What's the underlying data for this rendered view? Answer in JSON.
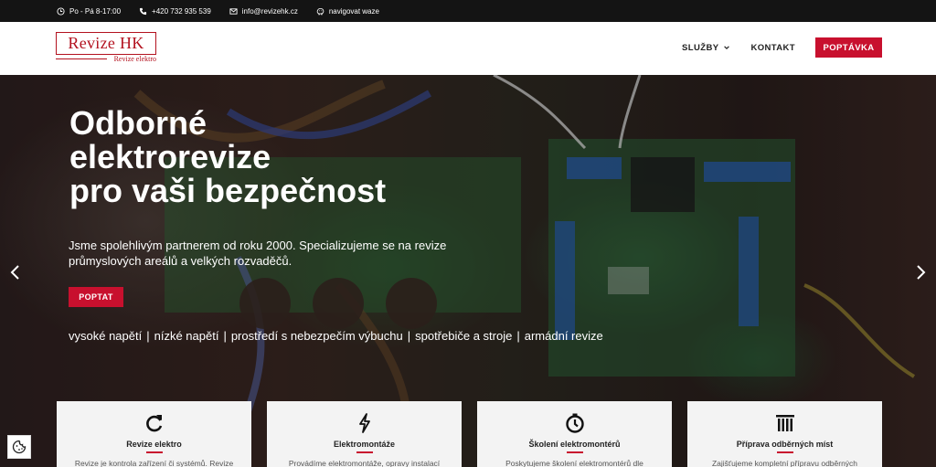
{
  "topbar": {
    "hours": "Po - Pá 8-17:00",
    "phone": "+420 732 935 539",
    "email": "info@revizehk.cz",
    "waze": "navigovat waze"
  },
  "header": {
    "logo_title": "Revize HK",
    "logo_subtitle": "Revize elektro",
    "nav": [
      {
        "label": "SLUŽBY"
      },
      {
        "label": "KONTAKT"
      }
    ],
    "cta_label": "POPTÁVKA"
  },
  "hero": {
    "title_lines": [
      "Odborné",
      "elektrorevize",
      "pro vaši bezpečnost"
    ],
    "text": "Jsme spolehlivým partnerem od roku 2000. Specializujeme se na revize průmyslových areálů a velkých rozvaděčů.",
    "button_label": "POPTAT",
    "tags": [
      "vysoké napětí",
      "nízké napětí",
      "prostředí s nebezpečím výbuchu",
      "spotřebiče a stroje",
      "armádní revize"
    ]
  },
  "cards": [
    {
      "icon": "refresh-icon",
      "title": "Revize elektro",
      "desc": "Revize je kontrola zařízení či systémů. Revize"
    },
    {
      "icon": "lightning-icon",
      "title": "Elektromontáže",
      "desc": "Provádíme elektromontáže, opravy instalací"
    },
    {
      "icon": "clock-icon",
      "title": "Školení elektromontérů",
      "desc": "Poskytujeme školení elektromontérů dle"
    },
    {
      "icon": "pillars-icon",
      "title": "Příprava odběrných míst",
      "desc": "Zajišťujeme kompletní přípravu odběrných"
    }
  ],
  "colors": {
    "accent": "#c8102e",
    "topbar": "#141414",
    "logo": "#b3121f"
  }
}
